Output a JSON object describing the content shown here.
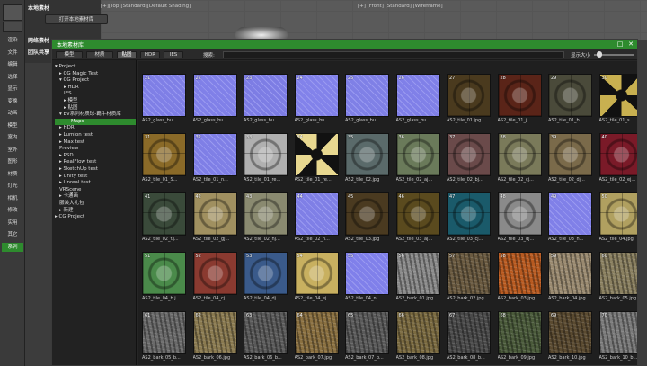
{
  "viewport": {
    "left_label": "[+][Top][Standard][Default Shading]",
    "right_label": "[+] [Front] [Standard] [Wireframe]"
  },
  "left_bar": {
    "items": [
      "渲染",
      "文件",
      "编辑",
      "选择",
      "显示",
      "变换",
      "动画",
      "模型",
      "室内",
      "室外",
      "图形",
      "材质",
      "灯光",
      "相机",
      "修改",
      "实用",
      "其它",
      "系列"
    ],
    "active_index": 17
  },
  "left_panel": {
    "title": "本地素材",
    "open_button": "打开本地素材库",
    "network_label": "网络素材",
    "team_label": "团队共享"
  },
  "window": {
    "title": "本地素材库",
    "tabs": [
      "模型",
      "材质",
      "贴图",
      "HDR",
      "IES"
    ],
    "active_tab": 2,
    "search_label": "搜索:",
    "search_placeholder": "",
    "size_label": "显示大小",
    "size_value": 0.08
  },
  "tree": [
    {
      "label": "Project",
      "level": 0,
      "expanded": true
    },
    {
      "label": "CG Magic Test",
      "level": 1,
      "expanded": false
    },
    {
      "label": "CG Project",
      "level": 1,
      "expanded": true
    },
    {
      "label": "HDR",
      "level": 2,
      "expanded": false
    },
    {
      "label": "IES",
      "level": 2,
      "expanded": null
    },
    {
      "label": "模型",
      "level": 2,
      "expanded": false
    },
    {
      "label": "贴图",
      "level": 2,
      "expanded": false
    },
    {
      "label": "EV系列材质球-霸牛材质库",
      "level": 1,
      "expanded": true
    },
    {
      "label": "Maps",
      "level": 2,
      "expanded": null,
      "selected": true
    },
    {
      "label": "HDR",
      "level": 1,
      "expanded": false
    },
    {
      "label": "Lumion test",
      "level": 1,
      "expanded": false
    },
    {
      "label": "Max test",
      "level": 1,
      "expanded": false
    },
    {
      "label": "Preview",
      "level": 1,
      "expanded": null
    },
    {
      "label": "PSD",
      "level": 1,
      "expanded": false
    },
    {
      "label": "RealFlow test",
      "level": 1,
      "expanded": false
    },
    {
      "label": "SketchUp test",
      "level": 1,
      "expanded": false
    },
    {
      "label": "Unity test",
      "level": 1,
      "expanded": false
    },
    {
      "label": "Unreal test",
      "level": 1,
      "expanded": false
    },
    {
      "label": "VRScene",
      "level": 1,
      "expanded": null
    },
    {
      "label": "卡通画",
      "level": 1,
      "expanded": false
    },
    {
      "label": "服装大礼包",
      "level": 1,
      "expanded": null
    },
    {
      "label": "新建",
      "level": 1,
      "expanded": false
    },
    {
      "label": "CG Project",
      "level": 0,
      "expanded": false
    }
  ],
  "thumbnails": [
    {
      "num": "21",
      "name": "AS2_glass_bu...",
      "color": "#7f7fe6",
      "pattern": "normal"
    },
    {
      "num": "22",
      "name": "AS2_glass_bu...",
      "color": "#8080e8",
      "pattern": "normal"
    },
    {
      "num": "23",
      "name": "AS2_glass_bu...",
      "color": "#7d7de4",
      "pattern": "normal"
    },
    {
      "num": "24",
      "name": "AS2_glass_bu...",
      "color": "#8282ea",
      "pattern": "normal"
    },
    {
      "num": "25",
      "name": "AS2_glass_bu...",
      "color": "#7f80e6",
      "pattern": "normal"
    },
    {
      "num": "26",
      "name": "AS2_glass_bu...",
      "color": "#8080e8",
      "pattern": "normal"
    },
    {
      "num": "27",
      "name": "AS2_tile_01.jpg",
      "color": "#4a3a1e",
      "pattern": "tile"
    },
    {
      "num": "28",
      "name": "AS2_tile_01_j...",
      "color": "#5a2418",
      "pattern": "tile"
    },
    {
      "num": "29",
      "name": "AS2_tile_01_b...",
      "color": "#4a4a3a",
      "pattern": "tile"
    },
    {
      "num": "30",
      "name": "AS2_tile_01_s...",
      "color": "#c8b050",
      "pattern": "star"
    },
    {
      "num": "31",
      "name": "AS2_tile_01_S...",
      "color": "#8a6a28",
      "pattern": "tile"
    },
    {
      "num": "32",
      "name": "AS2_tile_01_n...",
      "color": "#7f7fe6",
      "pattern": "normal"
    },
    {
      "num": "33",
      "name": "AS2_tile_01_re...",
      "color": "#b0b0b0",
      "pattern": "tile"
    },
    {
      "num": "34",
      "name": "AS2_tile_01_re...",
      "color": "#e8d890",
      "pattern": "star"
    },
    {
      "num": "35",
      "name": "AS2_tile_02.jpg",
      "color": "#5a6a6a",
      "pattern": "tile"
    },
    {
      "num": "36",
      "name": "AS2_tile_02_aj...",
      "color": "#6a7a5a",
      "pattern": "tile"
    },
    {
      "num": "37",
      "name": "AS2_tile_02_bj...",
      "color": "#6a4a4a",
      "pattern": "tile"
    },
    {
      "num": "38",
      "name": "AS2_tile_02_cj...",
      "color": "#7a7a5a",
      "pattern": "tile"
    },
    {
      "num": "39",
      "name": "AS2_tile_02_dj...",
      "color": "#7a6a4a",
      "pattern": "tile"
    },
    {
      "num": "40",
      "name": "AS2_tile_02_ej...",
      "color": "#7a1a28",
      "pattern": "tile"
    },
    {
      "num": "41",
      "name": "AS2_tile_02_f.j...",
      "color": "#3a4a3a",
      "pattern": "tile"
    },
    {
      "num": "42",
      "name": "AS2_tile_02_gj...",
      "color": "#a09060",
      "pattern": "tile"
    },
    {
      "num": "43",
      "name": "AS2_tile_02_hj...",
      "color": "#8a8a70",
      "pattern": "tile"
    },
    {
      "num": "44",
      "name": "AS2_tile_02_n...",
      "color": "#7f7fe6",
      "pattern": "normal"
    },
    {
      "num": "45",
      "name": "AS2_tile_03.jpg",
      "color": "#4a3a20",
      "pattern": "tile"
    },
    {
      "num": "46",
      "name": "AS2_tile_03_aj...",
      "color": "#5a4a1e",
      "pattern": "tile"
    },
    {
      "num": "47",
      "name": "AS2_tile_03_cj...",
      "color": "#1a5a6a",
      "pattern": "tile"
    },
    {
      "num": "48",
      "name": "AS2_tile_03_dj...",
      "color": "#8a8a8a",
      "pattern": "tile"
    },
    {
      "num": "49",
      "name": "AS2_tile_03_n...",
      "color": "#8080e8",
      "pattern": "normal"
    },
    {
      "num": "50",
      "name": "AS2_tile_04.jpg",
      "color": "#b0a060",
      "pattern": "tile"
    },
    {
      "num": "51",
      "name": "AS2_tile_04_b.j...",
      "color": "#4a8a4a",
      "pattern": "tile"
    },
    {
      "num": "52",
      "name": "AS2_tile_04_cj...",
      "color": "#8a3a30",
      "pattern": "tile"
    },
    {
      "num": "53",
      "name": "AS2_tile_04_dj...",
      "color": "#3a5a8a",
      "pattern": "tile"
    },
    {
      "num": "54",
      "name": "AS2_tile_04_ej...",
      "color": "#c8b060",
      "pattern": "tile"
    },
    {
      "num": "55",
      "name": "AS2_tile_04_n...",
      "color": "#8080ea",
      "pattern": "normal"
    },
    {
      "num": "56",
      "name": "AS2_bark_01.jpg",
      "color": "#8a8a8a",
      "pattern": "bark"
    },
    {
      "num": "57",
      "name": "AS2_bark_02.jpg",
      "color": "#6a5a40",
      "pattern": "bark"
    },
    {
      "num": "58",
      "name": "AS2_bark_03.jpg",
      "color": "#b85a20",
      "pattern": "bark"
    },
    {
      "num": "59",
      "name": "AS2_bark_04.jpg",
      "color": "#9a8a70",
      "pattern": "bark"
    },
    {
      "num": "60",
      "name": "AS2_bark_05.jpg",
      "color": "#8a8060",
      "pattern": "bark"
    },
    {
      "num": "61",
      "name": "AS2_bark_05_b...",
      "color": "#6a6a6a",
      "pattern": "bark"
    },
    {
      "num": "62",
      "name": "AS2_bark_06.jpg",
      "color": "#8a7a50",
      "pattern": "bark"
    },
    {
      "num": "63",
      "name": "AS2_bark_06_b...",
      "color": "#5a5a5a",
      "pattern": "bark"
    },
    {
      "num": "64",
      "name": "AS2_bark_07.jpg",
      "color": "#8a7040",
      "pattern": "bark"
    },
    {
      "num": "65",
      "name": "AS2_bark_07_b...",
      "color": "#5a5a5a",
      "pattern": "bark"
    },
    {
      "num": "66",
      "name": "AS2_bark_08.jpg",
      "color": "#7a6a40",
      "pattern": "bark"
    },
    {
      "num": "67",
      "name": "AS2_bark_08_b...",
      "color": "#4a4a4a",
      "pattern": "bark"
    },
    {
      "num": "68",
      "name": "AS2_bark_09.jpg",
      "color": "#4a5a3a",
      "pattern": "bark"
    },
    {
      "num": "69",
      "name": "AS2_bark_10.jpg",
      "color": "#5a4a30",
      "pattern": "bark"
    },
    {
      "num": "70",
      "name": "AS2_bark_10_b...",
      "color": "#7a7a7a",
      "pattern": "bark"
    }
  ]
}
